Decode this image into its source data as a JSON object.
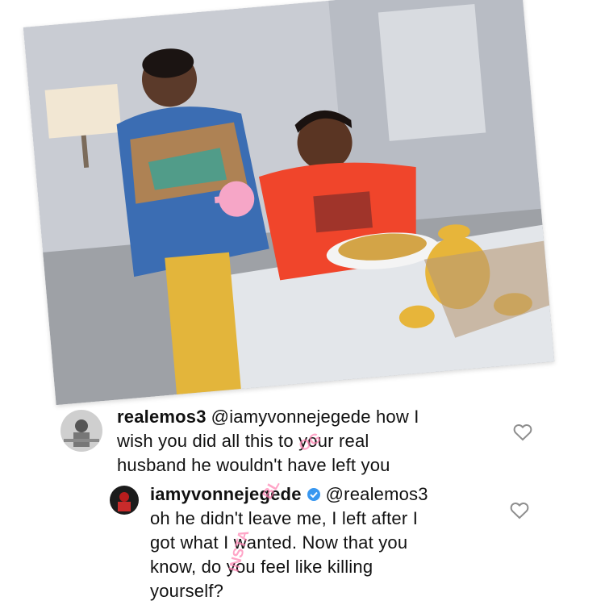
{
  "post": {
    "image_alt": "Woman holding a pink fan while a man in a red shirt eats at a dining table"
  },
  "comments": [
    {
      "username": "realemos3",
      "mention": "@iamyvonnejegede",
      "text": "how I wish you did all this to your real husband he  wouldn't have left you",
      "line1": "@iamyvonnejegede how I",
      "line2": "wish you did all this to your real",
      "line3": "husband he  wouldn't have left you"
    },
    {
      "username": "iamyvonnejegede",
      "verified": true,
      "mention": "@realemos3",
      "line1": "@realemos3",
      "line2": "oh he didn't leave me, I left after I",
      "line3": "got what I wanted. Now that you",
      "line4": "know, do you feel like killing",
      "line5": "yourself?"
    }
  ],
  "icons": {
    "like": "heart-outline-icon",
    "verified": "verified-badge-icon"
  },
  "colors": {
    "watermark": "#ff7fb0",
    "verified": "#3897f0",
    "heart": "#8e8e8e"
  }
}
